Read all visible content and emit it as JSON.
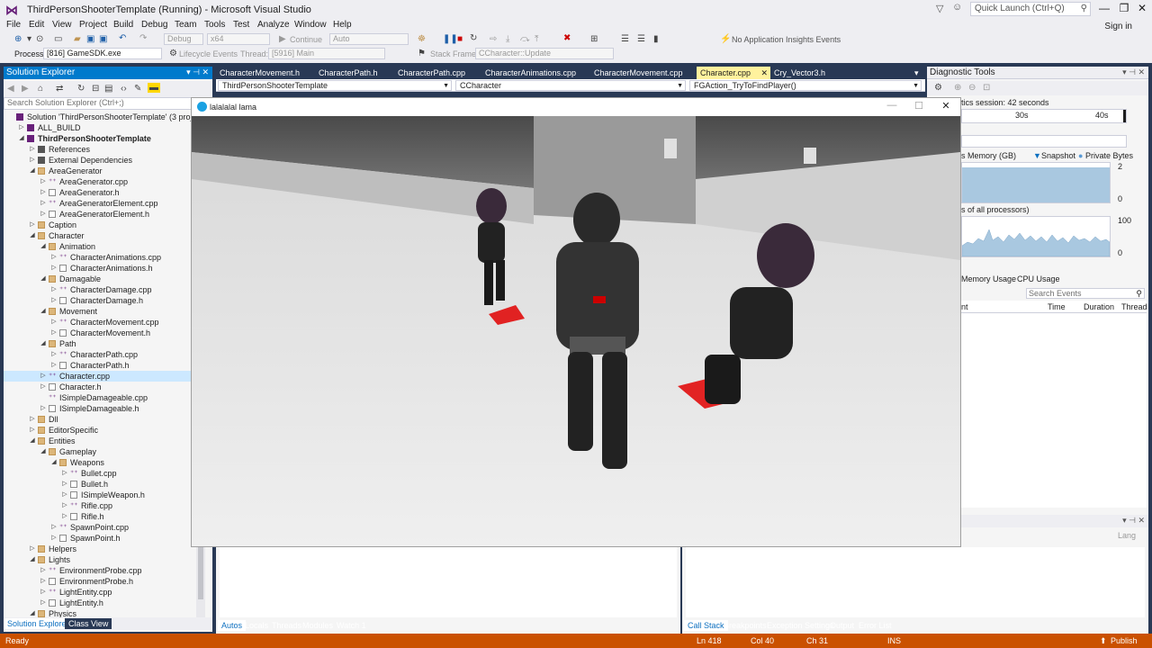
{
  "window": {
    "title": "ThirdPersonShooterTemplate (Running) - Microsoft Visual Studio",
    "quick_launch_placeholder": "Quick Launch (Ctrl+Q)",
    "sign_in": "Sign in",
    "logo_icon": "visual-studio-logo"
  },
  "menu": [
    "File",
    "Edit",
    "View",
    "Project",
    "Build",
    "Debug",
    "Team",
    "Tools",
    "Test",
    "Analyze",
    "Window",
    "Help"
  ],
  "toolbar": {
    "config": "Debug",
    "platform": "x64",
    "continue_label": "Continue",
    "auto_label": "Auto",
    "insights": "No Application Insights Events",
    "process_label": "Process:",
    "process_value": "[816] GameSDK.exe",
    "lifecycle_label": "Lifecycle Events",
    "thread_label": "Thread:",
    "thread_value": "[5916] Main",
    "stack_label": "Stack Frame:",
    "stack_value": "CCharacter::Update"
  },
  "solution_explorer": {
    "title": "Solution Explorer",
    "search_placeholder": "Search Solution Explorer (Ctrl+;)",
    "bottom_tabs": [
      "Solution Explorer",
      "Class View"
    ],
    "items": [
      {
        "label": "Solution 'ThirdPersonShooterTemplate' (3 projects)",
        "indent": 0,
        "icon": "sol",
        "arrow": ""
      },
      {
        "label": "ALL_BUILD",
        "indent": 1,
        "icon": "proj",
        "arrow": "▷"
      },
      {
        "label": "ThirdPersonShooterTemplate",
        "indent": 1,
        "icon": "proj",
        "arrow": "◢",
        "bold": true
      },
      {
        "label": "References",
        "indent": 2,
        "icon": "ref",
        "arrow": "▷"
      },
      {
        "label": "External Dependencies",
        "indent": 2,
        "icon": "ref",
        "arrow": "▷"
      },
      {
        "label": "AreaGenerator",
        "indent": 2,
        "icon": "folder",
        "arrow": "◢"
      },
      {
        "label": "AreaGenerator.cpp",
        "indent": 3,
        "icon": "cpp",
        "arrow": "▷"
      },
      {
        "label": "AreaGenerator.h",
        "indent": 3,
        "icon": "h",
        "arrow": "▷"
      },
      {
        "label": "AreaGeneratorElement.cpp",
        "indent": 3,
        "icon": "cpp",
        "arrow": "▷"
      },
      {
        "label": "AreaGeneratorElement.h",
        "indent": 3,
        "icon": "h",
        "arrow": "▷"
      },
      {
        "label": "Caption",
        "indent": 2,
        "icon": "folder",
        "arrow": "▷"
      },
      {
        "label": "Character",
        "indent": 2,
        "icon": "folder",
        "arrow": "◢"
      },
      {
        "label": "Animation",
        "indent": 3,
        "icon": "folder",
        "arrow": "◢"
      },
      {
        "label": "CharacterAnimations.cpp",
        "indent": 4,
        "icon": "cpp",
        "arrow": "▷"
      },
      {
        "label": "CharacterAnimations.h",
        "indent": 4,
        "icon": "h",
        "arrow": "▷"
      },
      {
        "label": "Damagable",
        "indent": 3,
        "icon": "folder",
        "arrow": "◢"
      },
      {
        "label": "CharacterDamage.cpp",
        "indent": 4,
        "icon": "cpp",
        "arrow": "▷"
      },
      {
        "label": "CharacterDamage.h",
        "indent": 4,
        "icon": "h",
        "arrow": "▷"
      },
      {
        "label": "Movement",
        "indent": 3,
        "icon": "folder",
        "arrow": "◢"
      },
      {
        "label": "CharacterMovement.cpp",
        "indent": 4,
        "icon": "cpp",
        "arrow": "▷"
      },
      {
        "label": "CharacterMovement.h",
        "indent": 4,
        "icon": "h",
        "arrow": "▷"
      },
      {
        "label": "Path",
        "indent": 3,
        "icon": "folder",
        "arrow": "◢"
      },
      {
        "label": "CharacterPath.cpp",
        "indent": 4,
        "icon": "cpp",
        "arrow": "▷"
      },
      {
        "label": "CharacterPath.h",
        "indent": 4,
        "icon": "h",
        "arrow": "▷"
      },
      {
        "label": "Character.cpp",
        "indent": 3,
        "icon": "cpp",
        "arrow": "▷",
        "selected": true
      },
      {
        "label": "Character.h",
        "indent": 3,
        "icon": "h",
        "arrow": "▷"
      },
      {
        "label": "ISimpleDamageable.cpp",
        "indent": 3,
        "icon": "cpp",
        "arrow": ""
      },
      {
        "label": "ISimpleDamageable.h",
        "indent": 3,
        "icon": "h",
        "arrow": "▷"
      },
      {
        "label": "Dll",
        "indent": 2,
        "icon": "folder",
        "arrow": "▷"
      },
      {
        "label": "EditorSpecific",
        "indent": 2,
        "icon": "folder",
        "arrow": "▷"
      },
      {
        "label": "Entities",
        "indent": 2,
        "icon": "folder",
        "arrow": "◢"
      },
      {
        "label": "Gameplay",
        "indent": 3,
        "icon": "folder",
        "arrow": "◢"
      },
      {
        "label": "Weapons",
        "indent": 4,
        "icon": "folder",
        "arrow": "◢"
      },
      {
        "label": "Bullet.cpp",
        "indent": 5,
        "icon": "cpp",
        "arrow": "▷"
      },
      {
        "label": "Bullet.h",
        "indent": 5,
        "icon": "h",
        "arrow": "▷"
      },
      {
        "label": "ISimpleWeapon.h",
        "indent": 5,
        "icon": "h",
        "arrow": "▷"
      },
      {
        "label": "Rifle.cpp",
        "indent": 5,
        "icon": "cpp",
        "arrow": "▷"
      },
      {
        "label": "Rifle.h",
        "indent": 5,
        "icon": "h",
        "arrow": "▷"
      },
      {
        "label": "SpawnPoint.cpp",
        "indent": 4,
        "icon": "cpp",
        "arrow": "▷"
      },
      {
        "label": "SpawnPoint.h",
        "indent": 4,
        "icon": "h",
        "arrow": "▷"
      },
      {
        "label": "Helpers",
        "indent": 2,
        "icon": "folder",
        "arrow": "▷"
      },
      {
        "label": "Lights",
        "indent": 2,
        "icon": "folder",
        "arrow": "◢"
      },
      {
        "label": "EnvironmentProbe.cpp",
        "indent": 3,
        "icon": "cpp",
        "arrow": "▷"
      },
      {
        "label": "EnvironmentProbe.h",
        "indent": 3,
        "icon": "h",
        "arrow": "▷"
      },
      {
        "label": "LightEntity.cpp",
        "indent": 3,
        "icon": "cpp",
        "arrow": "▷"
      },
      {
        "label": "LightEntity.h",
        "indent": 3,
        "icon": "h",
        "arrow": "▷"
      },
      {
        "label": "Physics",
        "indent": 2,
        "icon": "folder",
        "arrow": "◢"
      }
    ]
  },
  "editor": {
    "tabs": [
      "CharacterMovement.h",
      "CharacterPath.h",
      "CharacterPath.cpp",
      "CharacterAnimations.cpp",
      "CharacterMovement.cpp",
      "Character.cpp",
      "Cry_Vector3.h"
    ],
    "active_tab": "Character.cpp",
    "nav_project": "ThirdPersonShooterTemplate",
    "nav_class": "CCharacter",
    "nav_method": "FGAction_TryToFindPlayer()"
  },
  "game_window": {
    "title": "lalalalal lama",
    "icon": "app-icon"
  },
  "diagnostic_tools": {
    "title": "Diagnostic Tools",
    "session": "tics session: 42 seconds",
    "tick_30s": "30s",
    "tick_40s": "40s",
    "memory_label": "s Memory (GB)",
    "snapshot": "Snapshot",
    "private_bytes": "Private Bytes",
    "mem_max": "2",
    "mem_min": "0",
    "cpu_label": "s of all processors)",
    "cpu_max": "100",
    "cpu_min": "0",
    "tab_memory": "Memory Usage",
    "tab_cpu": "CPU Usage",
    "search_events": "Search Events",
    "col_name": "nt",
    "col_time": "Time",
    "col_duration": "Duration",
    "col_thread": "Thread",
    "lower_lang": "Lang"
  },
  "autos_panel": {
    "tabs": [
      "Autos",
      "Locals",
      "Threads",
      "Modules",
      "Watch 1"
    ]
  },
  "callstack_panel": {
    "tabs": [
      "Call Stack",
      "Breakpoints",
      "Exception Settings",
      "Output",
      "Error List"
    ]
  },
  "status": {
    "ready": "Ready",
    "ln": "Ln 418",
    "col": "Col 40",
    "ch": "Ch 31",
    "ins": "INS",
    "publish": "Publish"
  },
  "colors": {
    "accent": "#007ACC",
    "status_debug": "#CA5100",
    "dock_bg": "#293955",
    "active_tab": "#FFF29D"
  }
}
